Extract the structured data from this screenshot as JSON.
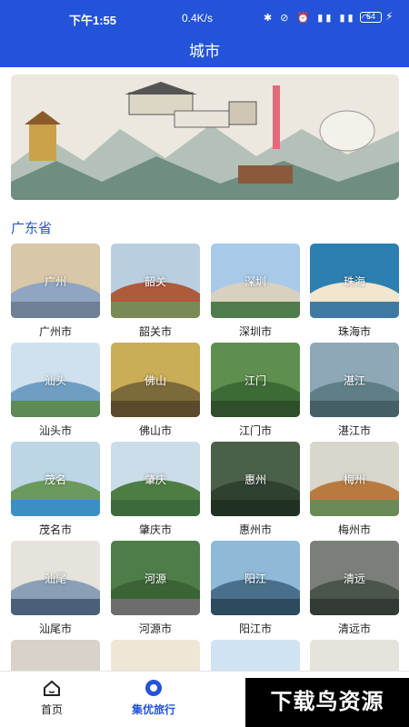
{
  "status": {
    "time": "下午1:55",
    "speed": "0.4K/s",
    "icons": "✱ ⊘ ⏰ ▮▮ ▮▮ ◠",
    "battery": "64",
    "bolt": "⚡"
  },
  "header": {
    "title": "城市"
  },
  "banner": {
    "image": "guangdong-landmarks-ink-painting"
  },
  "section": {
    "title": "广东省"
  },
  "cities": [
    {
      "label": "广州市",
      "overlay": "广州",
      "sky": "#d8c7a8",
      "hill": "#8fa5c2",
      "ground": "#6e7f96"
    },
    {
      "label": "韶关市",
      "overlay": "韶关",
      "sky": "#b9cfe0",
      "hill": "#b05a3c",
      "ground": "#7a8a55"
    },
    {
      "label": "深圳市",
      "overlay": "深圳",
      "sky": "#a9c9e8",
      "hill": "#d9d1c0",
      "ground": "#4f7c4a"
    },
    {
      "label": "珠海市",
      "overlay": "珠海",
      "sky": "#2c7fb1",
      "hill": "#f2e6cf",
      "ground": "#3f7aa3"
    },
    {
      "label": "汕头市",
      "overlay": "汕头",
      "sky": "#cfe1ef",
      "hill": "#6f9ec2",
      "ground": "#5d8a55"
    },
    {
      "label": "佛山市",
      "overlay": "佛山",
      "sky": "#c9ad57",
      "hill": "#7d6a3b",
      "ground": "#5a4a2b"
    },
    {
      "label": "江门市",
      "overlay": "江门",
      "sky": "#5f8f4f",
      "hill": "#3d6b36",
      "ground": "#2f4f2a"
    },
    {
      "label": "湛江市",
      "overlay": "湛江",
      "sky": "#8fa8b8",
      "hill": "#5f7f86",
      "ground": "#445f66"
    },
    {
      "label": "茂名市",
      "overlay": "茂名",
      "sky": "#bcd6e6",
      "hill": "#6c9a5e",
      "ground": "#3b8fc3"
    },
    {
      "label": "肇庆市",
      "overlay": "肇庆",
      "sky": "#cbdde8",
      "hill": "#4e7d44",
      "ground": "#3d6a3a"
    },
    {
      "label": "惠州市",
      "overlay": "惠州",
      "sky": "#4b6049",
      "hill": "#2f4230",
      "ground": "#203022"
    },
    {
      "label": "梅州市",
      "overlay": "梅州",
      "sky": "#d9d6cc",
      "hill": "#b87a3e",
      "ground": "#6a8a56"
    },
    {
      "label": "汕尾市",
      "overlay": "汕尾",
      "sky": "#e6e3dc",
      "hill": "#8a9fb6",
      "ground": "#4a5f78"
    },
    {
      "label": "河源市",
      "overlay": "河源",
      "sky": "#4f7d49",
      "hill": "#3a6336",
      "ground": "#6d6d6d"
    },
    {
      "label": "阳江市",
      "overlay": "阳江",
      "sky": "#8fb9d6",
      "hill": "#4a6f8a",
      "ground": "#2d4a5e"
    },
    {
      "label": "清远市",
      "overlay": "清远",
      "sky": "#7a7f7a",
      "hill": "#4c554c",
      "ground": "#333a33"
    }
  ],
  "partial_cities": [
    {
      "sky": "#d8d2c8",
      "hill": "#6f6a62",
      "ground": "#4a453f"
    },
    {
      "sky": "#efe7d6",
      "hill": "#a4824e",
      "ground": "#7a5f3a"
    },
    {
      "sky": "#cfe3f2",
      "hill": "#9b3b2c",
      "ground": "#5a2a22"
    },
    {
      "sky": "#e6e3dd",
      "hill": "#9a9a92",
      "ground": "#6c6c66"
    }
  ],
  "bottom_nav": [
    {
      "label": "首页",
      "icon": "home-icon",
      "active": false
    },
    {
      "label": "集优旅行",
      "icon": "travel-icon",
      "active": true
    }
  ],
  "watermark": {
    "text": "下载鸟资源"
  },
  "colors": {
    "primary": "#2353d8"
  }
}
